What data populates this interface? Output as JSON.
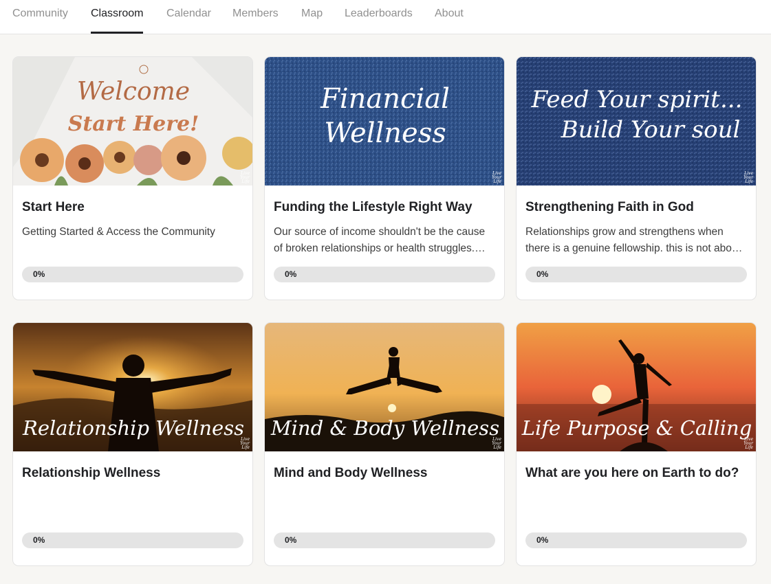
{
  "nav": {
    "tabs": [
      {
        "label": "Community",
        "active": false
      },
      {
        "label": "Classroom",
        "active": true
      },
      {
        "label": "Calendar",
        "active": false
      },
      {
        "label": "Members",
        "active": false
      },
      {
        "label": "Map",
        "active": false
      },
      {
        "label": "Leaderboards",
        "active": false
      },
      {
        "label": "About",
        "active": false
      }
    ]
  },
  "colors": {
    "accent": "#202124",
    "background": "#f7f6f3",
    "progress_track": "#e4e4e4"
  },
  "courses": [
    {
      "cover": {
        "line1": "Welcome",
        "line2": "Start Here!",
        "theme": "flowers"
      },
      "title": "Start Here",
      "description": "Getting Started & Access the Community",
      "progress": {
        "label": "0%",
        "value": 0
      }
    },
    {
      "cover": {
        "line1": "Financial",
        "line2": "Wellness",
        "theme": "denim"
      },
      "title": "Funding the Lifestyle Right Way",
      "description": "Our source of income shouldn't be the cause of broken relationships or health struggles. Let's learn how to fund the lifestyle the right way.",
      "progress": {
        "label": "0%",
        "value": 0
      }
    },
    {
      "cover": {
        "line1": "Feed Your spirit...",
        "line2": "Build Your soul",
        "theme": "denim"
      },
      "title": "Strengthening Faith in God",
      "description": "Relationships grow and strengthens when there is a genuine fellowship. this is not about religion but a relationship.",
      "progress": {
        "label": "0%",
        "value": 0
      }
    },
    {
      "cover": {
        "line1": "Relationship Wellness",
        "theme": "sunset-arms"
      },
      "title": "Relationship Wellness",
      "description": "",
      "progress": {
        "label": "0%",
        "value": 0
      }
    },
    {
      "cover": {
        "line1": "Mind & Body Wellness",
        "theme": "sunset-jump"
      },
      "title": "Mind and Body Wellness",
      "description": "",
      "progress": {
        "label": "0%",
        "value": 0
      }
    },
    {
      "cover": {
        "line1": "Life Purpose & Calling",
        "theme": "sunset-kick"
      },
      "title": "What are you here on Earth to do?",
      "description": "",
      "progress": {
        "label": "0%",
        "value": 0
      }
    }
  ]
}
